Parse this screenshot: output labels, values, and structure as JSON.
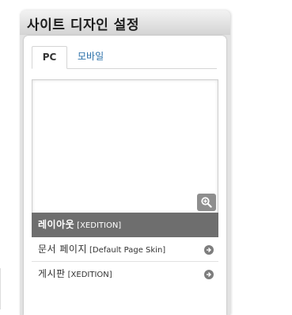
{
  "panel": {
    "title": "사이트 디자인 설정"
  },
  "tabs": [
    {
      "label": "PC",
      "active": true
    },
    {
      "label": "모바일",
      "active": false
    }
  ],
  "preview": {
    "zoom_icon": "zoom-in-icon"
  },
  "items": [
    {
      "name": "레이아웃",
      "skin": "[XEDITION]",
      "selected": true,
      "icon": ""
    },
    {
      "name": "문서 페이지",
      "skin": "[Default Page Skin]",
      "selected": false,
      "icon": "arrow-right-circle-icon"
    },
    {
      "name": "게시판",
      "skin": "[XEDITION]",
      "selected": false,
      "icon": "arrow-right-circle-icon"
    }
  ],
  "colors": {
    "tab_link": "#2a6fa8",
    "selected_row_bg": "#6e6e6e",
    "header_gradient_top": "#f2f2f2",
    "header_gradient_bottom": "#d4d4d4"
  }
}
